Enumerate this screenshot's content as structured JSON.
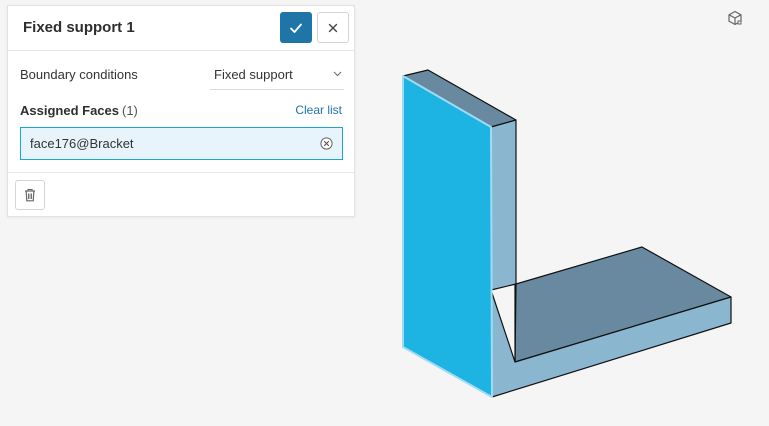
{
  "panel": {
    "title": "Fixed support 1",
    "confirm_icon": "check-icon",
    "close_icon": "close-icon"
  },
  "boundary_conditions": {
    "label": "Boundary conditions",
    "selected": "Fixed support"
  },
  "assigned_faces": {
    "label": "Assigned Faces",
    "count": "(1)",
    "clear_label": "Clear list",
    "items": [
      "face176@Bracket"
    ]
  },
  "footer": {
    "delete_icon": "trash-icon"
  },
  "viewport": {
    "view_cube_icon": "view-cube-icon",
    "colors": {
      "selected_face": "#1db3e3",
      "side_face": "#8ab6d0",
      "top_face": "#6889a0",
      "background": "#f5f5f5"
    }
  },
  "colors": {
    "accent": "#1f74a8",
    "chip_border": "#1da5d6",
    "chip_bg": "#e8f4fb"
  }
}
